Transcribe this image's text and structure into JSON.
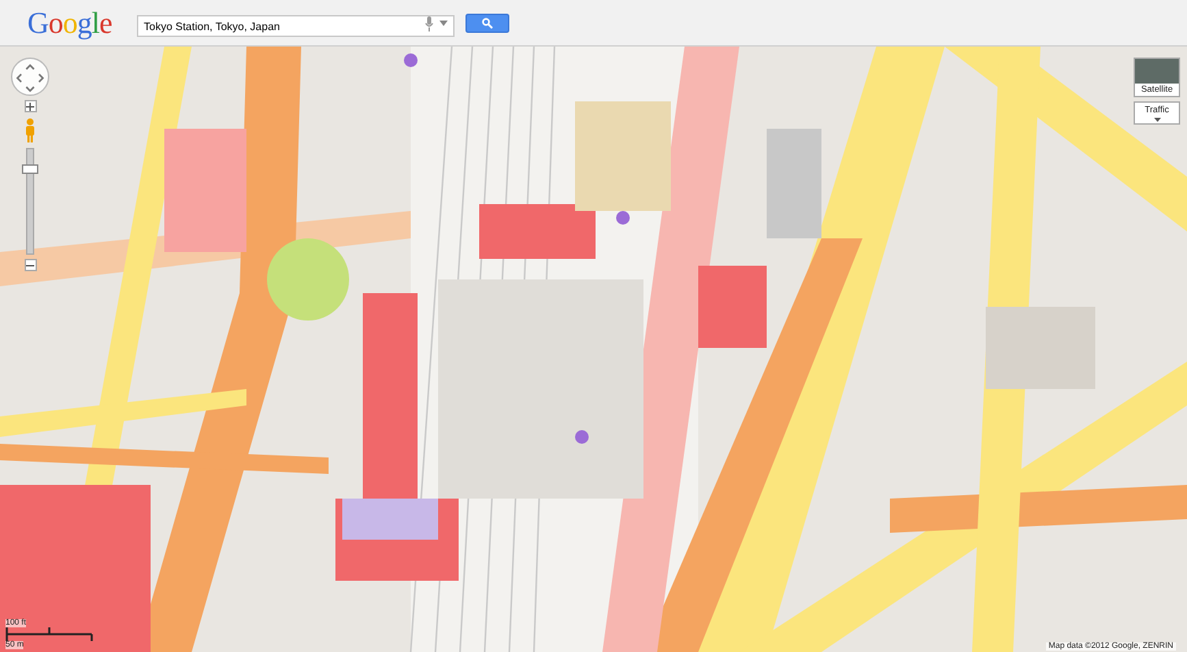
{
  "header": {
    "logo": "Google",
    "search": {
      "value": "Tokyo Station, Tokyo, Japan"
    }
  },
  "map": {
    "zoom": {
      "level": 0.85
    },
    "layers": [
      {
        "kind": "thumbnail",
        "label": "Satellite"
      },
      {
        "kind": "dropdown",
        "label": "Traffic"
      }
    ],
    "scale": {
      "feet": "100 ft",
      "meters": "50 m"
    },
    "attribution": "Map data ©2012 Google, ZENRIN"
  }
}
